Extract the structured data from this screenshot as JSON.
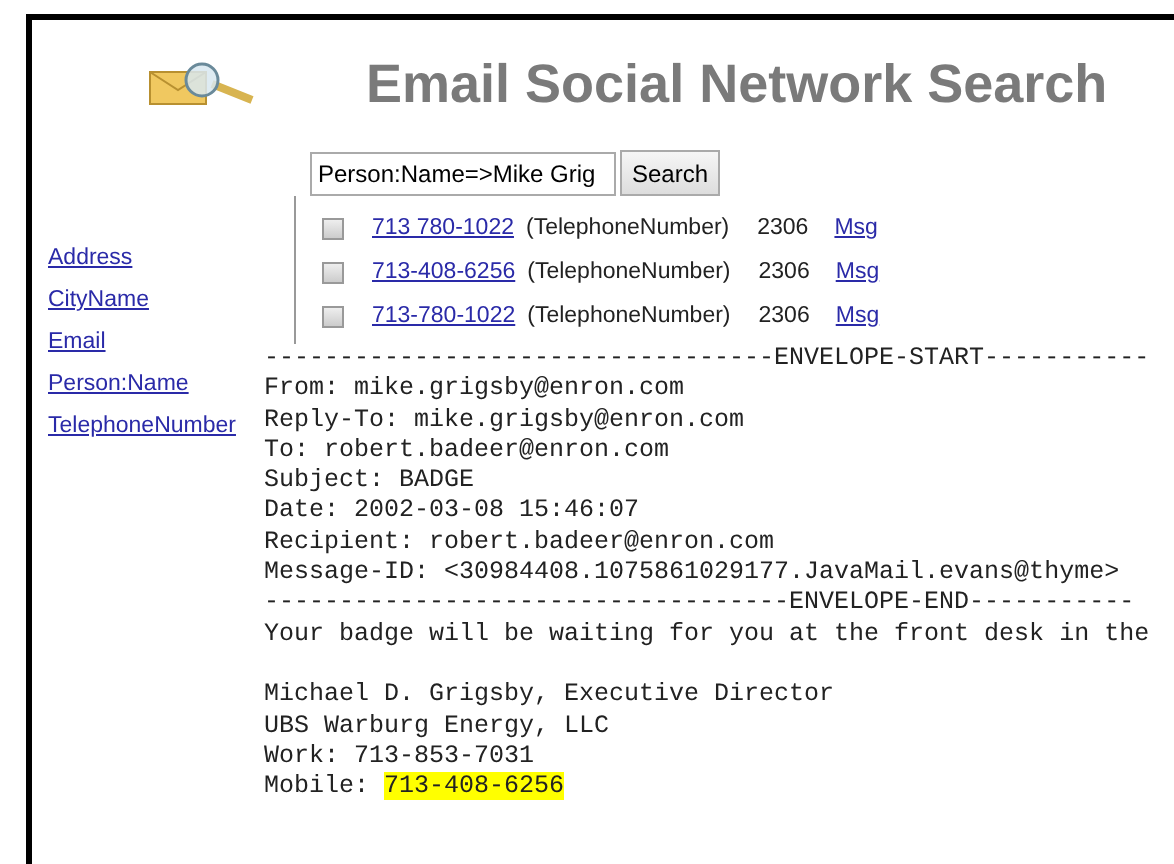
{
  "header": {
    "title": "Email Social Network Search"
  },
  "search": {
    "value": "Person:Name=>Mike Grig",
    "button": "Search"
  },
  "sidebar": {
    "items": [
      {
        "label": "Address"
      },
      {
        "label": "CityName"
      },
      {
        "label": "Email"
      },
      {
        "label": "Person:Name"
      },
      {
        "label": "TelephoneNumber"
      }
    ]
  },
  "results": [
    {
      "checked": false,
      "value": "713 780-1022",
      "type": "(TelephoneNumber)",
      "count": "2306",
      "link": "Msg"
    },
    {
      "checked": false,
      "value": "713-408-6256",
      "type": "(TelephoneNumber)",
      "count": "2306",
      "link": "Msg"
    },
    {
      "checked": false,
      "value": "713-780-1022",
      "type": "(TelephoneNumber)",
      "count": "2306",
      "link": "Msg"
    }
  ],
  "message": {
    "lines": [
      {
        "text": "----------------------------------ENVELOPE-START-----------"
      },
      {
        "text": "From: mike.grigsby@enron.com"
      },
      {
        "text": "Reply-To: mike.grigsby@enron.com"
      },
      {
        "text": "To: robert.badeer@enron.com"
      },
      {
        "text": "Subject: BADGE"
      },
      {
        "text": "Date: 2002-03-08 15:46:07"
      },
      {
        "text": "Recipient: robert.badeer@enron.com"
      },
      {
        "text": "Message-ID: <30984408.1075861029177.JavaMail.evans@thyme>"
      },
      {
        "text": "-----------------------------------ENVELOPE-END-----------"
      },
      {
        "text": "Your badge will be waiting for you at the front desk in the"
      },
      {
        "text": "Michael D. Grigsby, Executive Director",
        "gap_before": true
      },
      {
        "text": "UBS Warburg Energy, LLC"
      },
      {
        "text": "Work: 713-853-7031"
      },
      {
        "text": "Mobile: ",
        "highlight": "713-408-6256"
      }
    ]
  }
}
